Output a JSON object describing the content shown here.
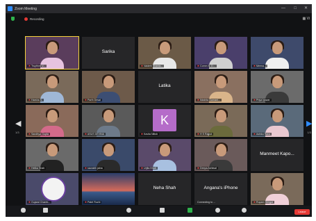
{
  "window": {
    "title": "Zoom Meeting"
  },
  "status": {
    "recording_label": "Recording",
    "view_label": "Vi"
  },
  "tiles": [
    {
      "label": "Trupthee V...",
      "center": "",
      "kind": "person"
    },
    {
      "label": "",
      "center": "Sarika",
      "kind": "name"
    },
    {
      "label": "Vaidehi Sharda...",
      "center": "",
      "kind": "person"
    },
    {
      "label": "Comm B. D...",
      "center": "",
      "kind": "person"
    },
    {
      "label": "Meena...",
      "center": "",
      "kind": "person"
    },
    {
      "label": "Harsha S.",
      "center": "",
      "kind": "person"
    },
    {
      "label": "Parth Desai",
      "center": "",
      "kind": "person"
    },
    {
      "label": "",
      "center": "Latika",
      "kind": "name"
    },
    {
      "label": "Ikkshita Gurnani...",
      "center": "",
      "kind": "person"
    },
    {
      "label": "Priya Iyswar",
      "center": "",
      "kind": "person"
    },
    {
      "label": "Sandhya Gupta",
      "center": "",
      "kind": "person"
    },
    {
      "label": "ASUS DEVINA",
      "center": "",
      "kind": "person"
    },
    {
      "label": "Kavita Nitish",
      "center": "K",
      "kind": "avatar"
    },
    {
      "label": "H S Rajput",
      "center": "",
      "kind": "person"
    },
    {
      "label": "Ashika Rana",
      "center": "",
      "kind": "person"
    },
    {
      "label": "Helika Shah",
      "center": "",
      "kind": "person"
    },
    {
      "label": "saurabh jalna",
      "center": "",
      "kind": "person"
    },
    {
      "label": "Urjita Bhatt",
      "center": "",
      "kind": "person"
    },
    {
      "label": "Deepa Ashiwal",
      "center": "",
      "kind": "person"
    },
    {
      "label": "",
      "center": "Manmeet Kapo...",
      "kind": "name"
    },
    {
      "label": "Gujarat Chamb...",
      "center": "",
      "kind": "logo"
    },
    {
      "label": "Patel Ruchi",
      "center": "",
      "kind": "scenery"
    },
    {
      "label": "",
      "center": "Neha Shah",
      "kind": "name"
    },
    {
      "label": "Connecting to ...",
      "center": "Angana's iPhone",
      "kind": "connecting"
    },
    {
      "label": "Rupam Shirgot",
      "center": "",
      "kind": "person"
    }
  ],
  "nav": {
    "page_left": "1/3",
    "page_right": "1/3"
  },
  "toolbar": {
    "leave_label": "Leave"
  },
  "colors": {
    "active_speaker": "#f5d33a",
    "zoom_blue": "#2d8cff",
    "leave_red": "#e53935"
  }
}
